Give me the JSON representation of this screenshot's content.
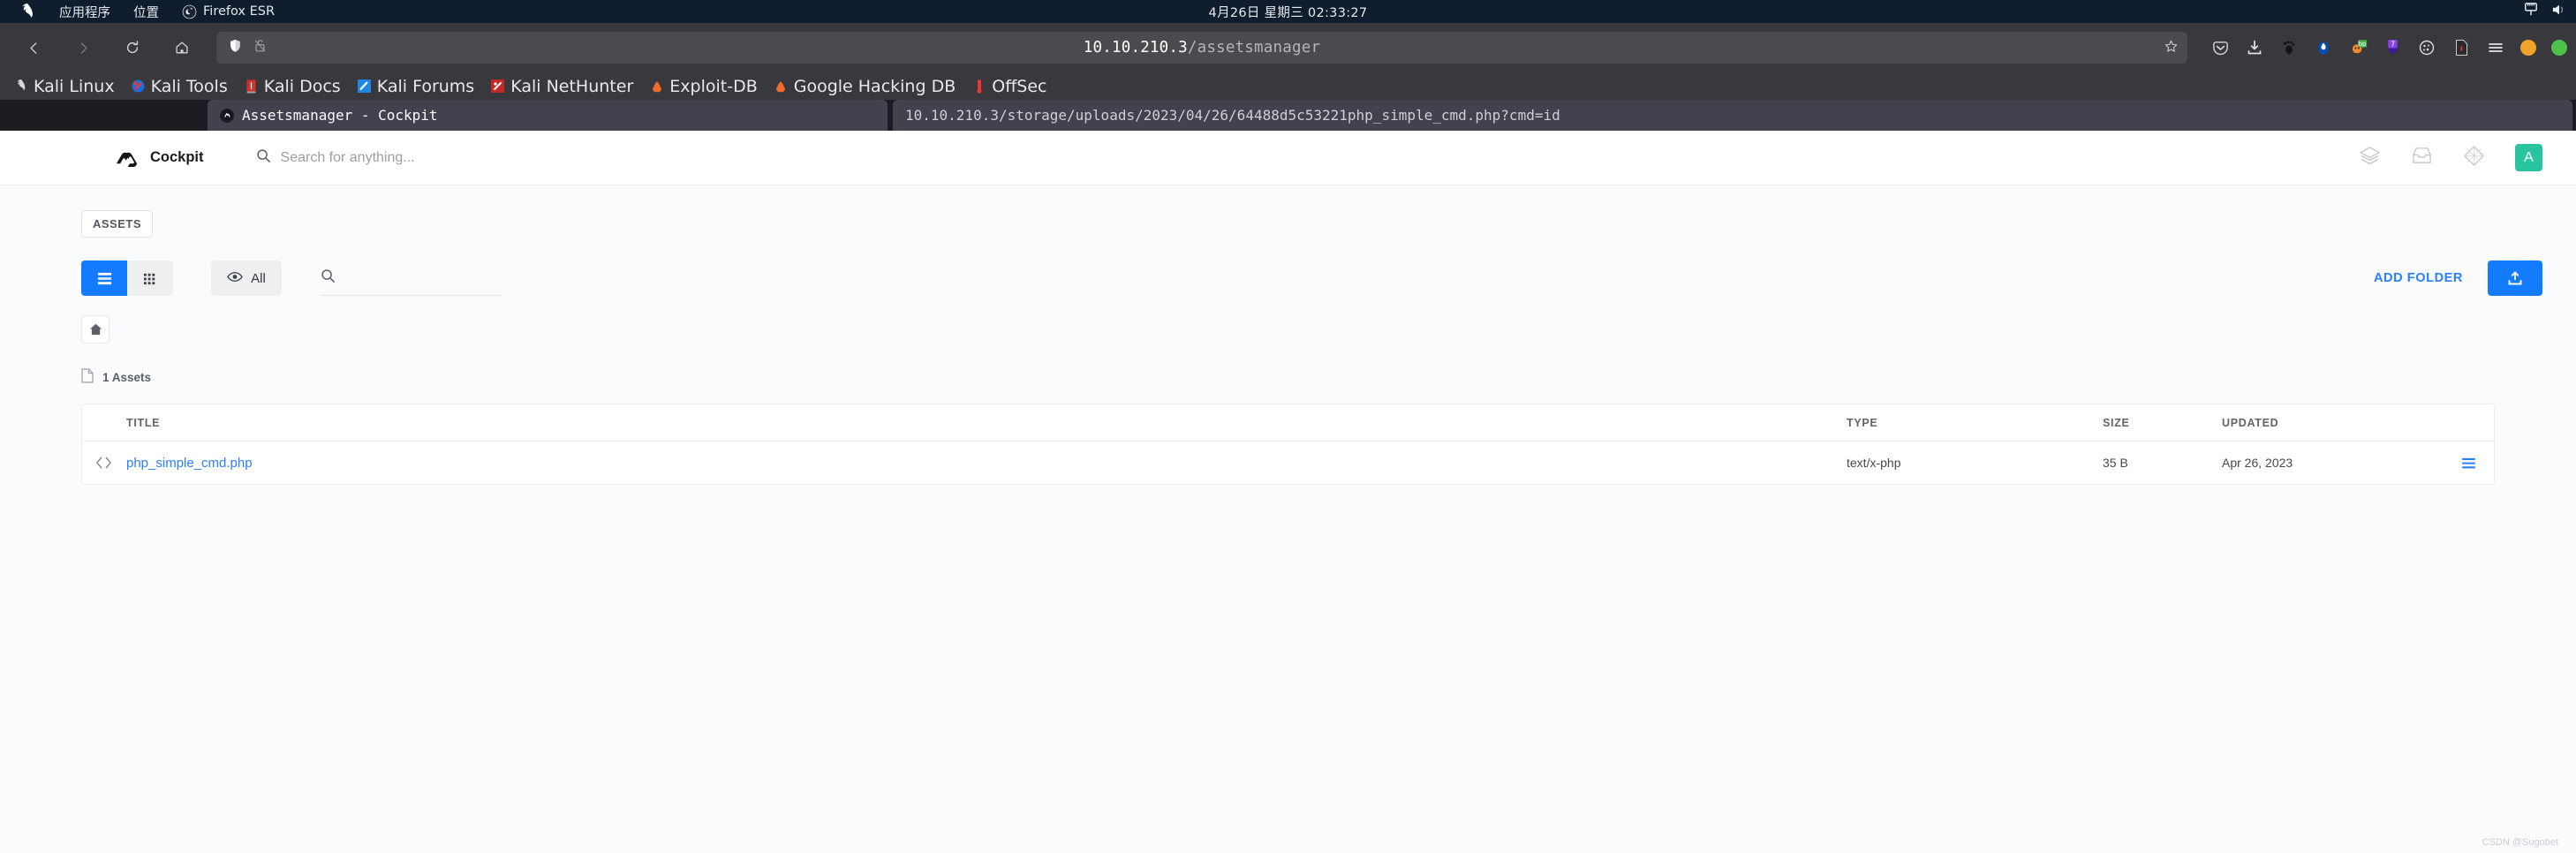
{
  "os_panel": {
    "logo_icon": "kali-dragon-icon",
    "menus": [
      {
        "label": "应用程序",
        "icon": "applications-icon"
      },
      {
        "label": "位置",
        "icon": "places-icon"
      },
      {
        "label": "Firefox ESR",
        "icon": "firefox-icon"
      }
    ],
    "clock": "4月26日 星期三  02:33:27",
    "tray": [
      "network-wired-icon",
      "volume-icon"
    ]
  },
  "browser": {
    "nav": {
      "back_icon": "back-arrow-icon",
      "forward_icon": "forward-arrow-icon",
      "reload_icon": "reload-icon",
      "home_icon": "home-icon"
    },
    "urlbar": {
      "shield_icon": "shield-icon",
      "insecure_icon": "unlocked-padlock-icon",
      "host": "10.10.210.3",
      "path": "/assetsmanager",
      "bookmark_icon": "star-icon"
    },
    "toolbar_icons": [
      "pocket-icon",
      "downloads-icon",
      "gnome-footprint-icon",
      "blue-drop-icon",
      "foxyproxy-bp-icon",
      "purple-seven-icon",
      "cookie-icon",
      "red-document-icon",
      "hamburger-menu-icon"
    ],
    "window_buttons": [
      "minimize-orange-dot",
      "maximize-green-dot"
    ],
    "bookmarks": [
      {
        "label": "Kali Linux",
        "icon": "kali-dragon-icon"
      },
      {
        "label": "Kali Tools",
        "icon": "kali-tools-icon"
      },
      {
        "label": "Kali Docs",
        "icon": "kali-docs-icon"
      },
      {
        "label": "Kali Forums",
        "icon": "kali-forums-icon"
      },
      {
        "label": "Kali NetHunter",
        "icon": "kali-nethunter-icon"
      },
      {
        "label": "Exploit-DB",
        "icon": "exploit-db-icon"
      },
      {
        "label": "Google Hacking DB",
        "icon": "google-hacking-db-icon"
      },
      {
        "label": "OffSec",
        "icon": "offsec-icon"
      }
    ],
    "tabs": [
      {
        "label": "Assetsmanager - Cockpit",
        "favicon": "cockpit-favicon",
        "active": true
      },
      {
        "label": "10.10.210.3/storage/uploads/2023/04/26/64488d5c53221php_simple_cmd.php?cmd=id",
        "favicon": "none",
        "active": false
      }
    ]
  },
  "cockpit": {
    "brand": "Cockpit",
    "brand_logo_icon": "cockpit-logo-icon",
    "search": {
      "icon": "search-icon",
      "placeholder": "Search for anything..."
    },
    "header_icons": [
      "layers-icon",
      "inbox-icon",
      "diamond-icon"
    ],
    "avatar_initial": "A",
    "accent_color": "#137bff",
    "avatar_color": "#2bc4a0",
    "breadcrumb_chip": "ASSETS",
    "toolbar": {
      "list_view_icon": "list-view-icon",
      "grid_view_icon": "grid-view-icon",
      "filter_label": "All",
      "filter_icon": "eye-icon",
      "search_icon": "search-icon",
      "search_value": "",
      "add_folder_label": "ADD FOLDER",
      "upload_icon": "upload-icon"
    },
    "path_home_icon": "home-icon",
    "assets_count_label": "1 Assets",
    "assets_count_icon": "file-icon",
    "table": {
      "columns": [
        "TITLE",
        "TYPE",
        "SIZE",
        "UPDATED"
      ],
      "rows": [
        {
          "icon": "code-file-icon",
          "title": "php_simple_cmd.php",
          "type": "text/x-php",
          "size": "35 B",
          "updated": "Apr 26, 2023",
          "actions_icon": "row-menu-icon"
        }
      ]
    },
    "watermark": "CSDN @Sugobet"
  }
}
